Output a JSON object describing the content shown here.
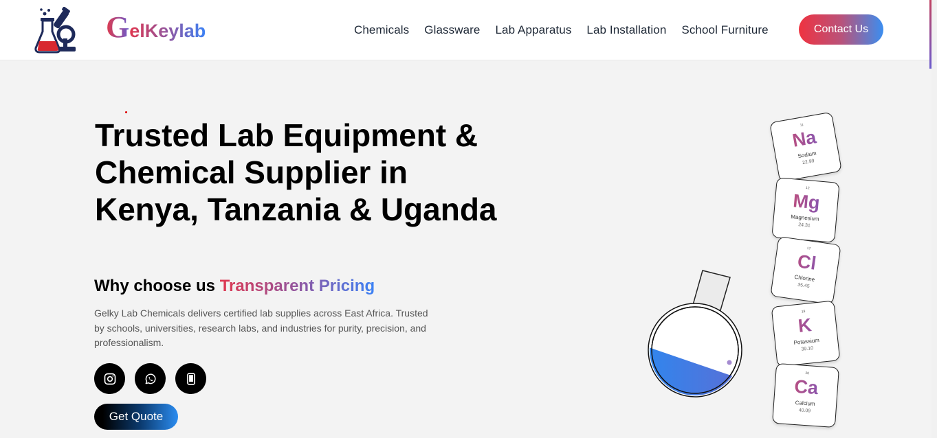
{
  "brand": {
    "g": "G",
    "rest": "elKeylab"
  },
  "nav": [
    "Chemicals",
    "Glassware",
    "Lab Apparatus",
    "Lab Installation",
    "School Furniture"
  ],
  "contact_label": "Contact Us",
  "hero": {
    "title": "Trusted Lab Equipment & Chemical Supplier in Kenya, Tanzania & Uganda",
    "why_prefix": "Why choose us",
    "why_highlight": "Transparent Pricing",
    "description": "Gelky Lab Chemicals delivers certified lab supplies across East Africa. Trusted by schools, universities, research labs, and industries for purity, precision, and professionalism.",
    "quote_label": "Get Quote"
  },
  "socials": [
    {
      "icon": "instagram-icon"
    },
    {
      "icon": "whatsapp-icon"
    },
    {
      "icon": "phone-icon"
    }
  ],
  "elements": [
    {
      "number": "11",
      "symbol": "Na",
      "name": "Sodium",
      "weight": "22.99"
    },
    {
      "number": "12",
      "symbol": "Mg",
      "name": "Magnesium",
      "weight": "24.31"
    },
    {
      "number": "17",
      "symbol": "Cl",
      "name": "Chlorine",
      "weight": "35.45"
    },
    {
      "number": "19",
      "symbol": "K",
      "name": "Potassium",
      "weight": "39.10"
    },
    {
      "number": "20",
      "symbol": "Ca",
      "name": "Calcium",
      "weight": "40.09"
    }
  ],
  "colors": {
    "accent_red": "#ef3340",
    "accent_blue": "#3b82f6",
    "liquid": "#2f86ee"
  }
}
